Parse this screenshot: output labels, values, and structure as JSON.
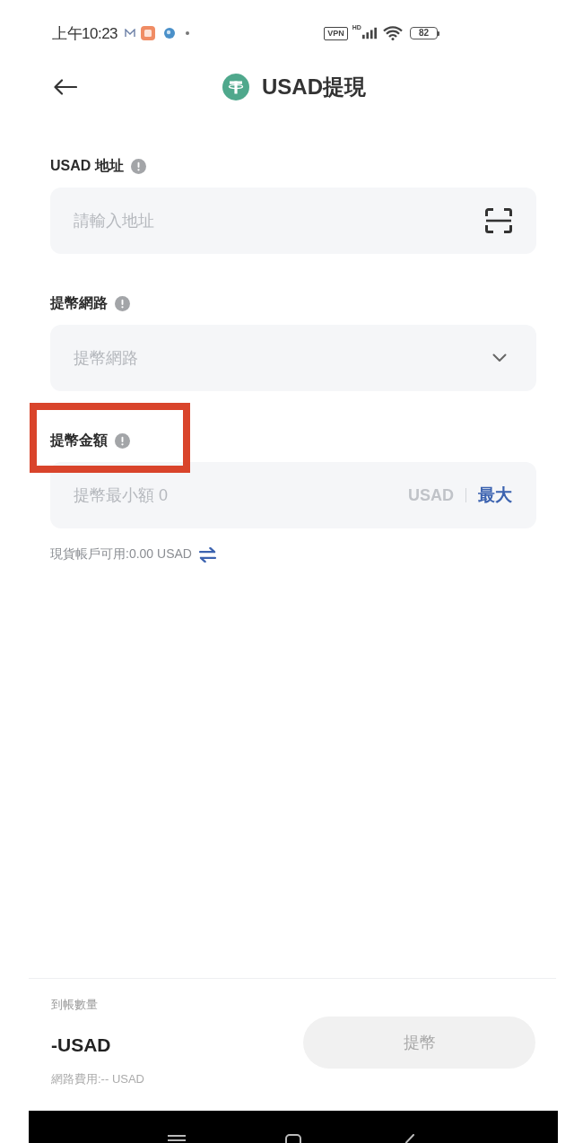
{
  "status_bar": {
    "time": "上午10:23",
    "vpn_label": "VPN",
    "signal_label": "HD",
    "battery": "82"
  },
  "header": {
    "title": "USAD提現"
  },
  "fields": [
    {
      "kind": "address",
      "label": "USAD 地址",
      "placeholder": "請輸入地址",
      "highlighted": false
    },
    {
      "kind": "select",
      "label": "提幣網路",
      "placeholder": "提幣網路",
      "highlighted": false
    },
    {
      "kind": "amount",
      "label": "提幣金額",
      "placeholder": "提幣最小額 0",
      "unit": "USAD",
      "max_button": "最大",
      "highlighted": true
    }
  ],
  "available": {
    "text": "現貨帳戶可用:0.00 USAD"
  },
  "footer": {
    "received_label": "到帳數量",
    "received_value": "-USAD",
    "fee": "網路費用:-- USAD",
    "submit_button": {
      "label": "提幣",
      "disabled": true
    }
  }
}
